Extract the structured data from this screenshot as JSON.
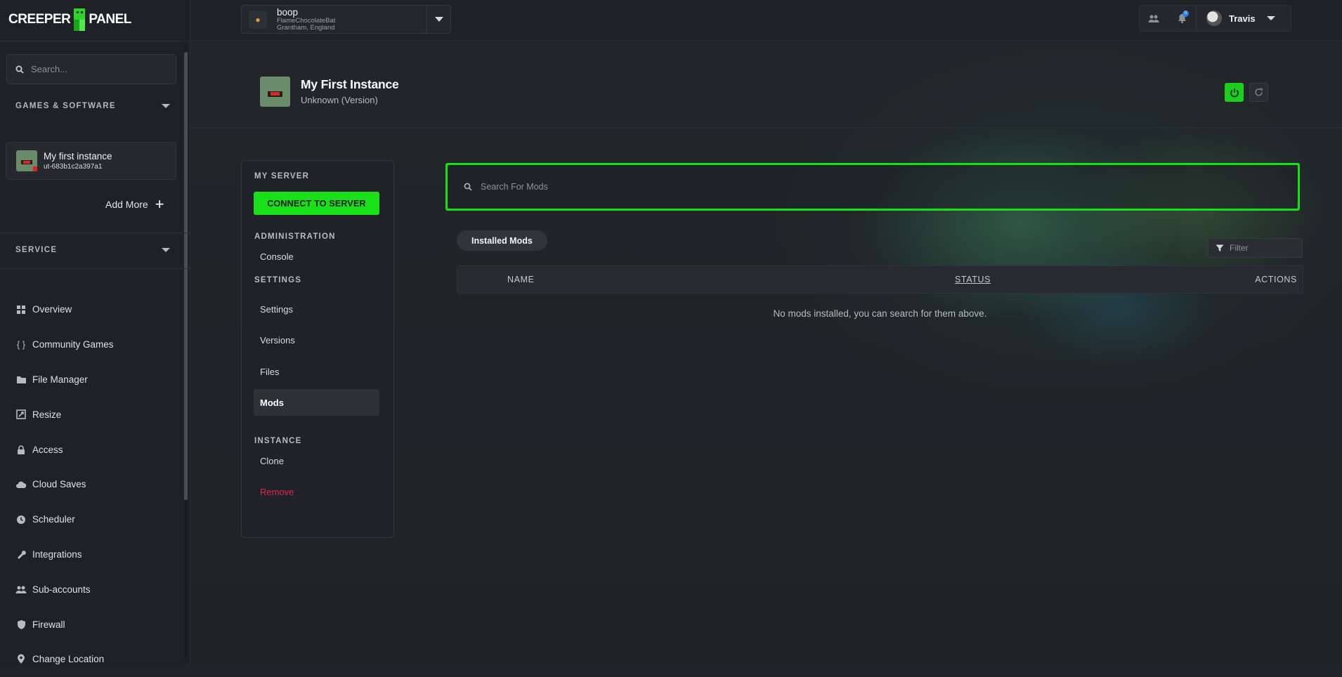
{
  "brand": {
    "left": "CREEPER",
    "right": "PANEL"
  },
  "sidebar": {
    "search_placeholder": "Search...",
    "games_section": "GAMES & SOFTWARE",
    "instance": {
      "title": "My first instance",
      "id": "ut-683b1c2a397a1"
    },
    "add_more": "Add More",
    "service_section": "SERVICE",
    "items": [
      {
        "label": "Overview",
        "icon": "grid-icon"
      },
      {
        "label": "Community Games",
        "icon": "braces-icon"
      },
      {
        "label": "File Manager",
        "icon": "folder-icon"
      },
      {
        "label": "Resize",
        "icon": "resize-icon"
      },
      {
        "label": "Access",
        "icon": "lock-icon"
      },
      {
        "label": "Cloud Saves",
        "icon": "cloud-icon"
      },
      {
        "label": "Scheduler",
        "icon": "clock-icon"
      },
      {
        "label": "Integrations",
        "icon": "wrench-icon"
      },
      {
        "label": "Sub-accounts",
        "icon": "users-icon"
      },
      {
        "label": "Firewall",
        "icon": "shield-icon"
      },
      {
        "label": "Change Location",
        "icon": "pin-icon"
      }
    ]
  },
  "topbar": {
    "server": {
      "name": "boop",
      "host": "FlameChocolateBat",
      "location": "Grantham, England"
    },
    "notification_count": "0",
    "user_name": "Travis"
  },
  "page": {
    "title": "My First Instance",
    "subtitle": "Unknown (Version)"
  },
  "menu": {
    "my_server": "MY SERVER",
    "connect": "CONNECT TO SERVER",
    "administration": "ADMINISTRATION",
    "console": "Console",
    "settings_section": "SETTINGS",
    "settings": "Settings",
    "versions": "Versions",
    "files": "Files",
    "mods": "Mods",
    "instance_section": "INSTANCE",
    "clone": "Clone",
    "remove": "Remove"
  },
  "mods": {
    "search_placeholder": "Search For Mods",
    "tab": "Installed Mods",
    "filter_placeholder": "Filter",
    "columns": {
      "name": "NAME",
      "status": "STATUS",
      "actions": "ACTIONS"
    },
    "empty": "No mods installed, you can search for them above."
  },
  "colors": {
    "accent": "#19e019",
    "danger": "#e0245a",
    "badge": "#2a7ef0"
  }
}
